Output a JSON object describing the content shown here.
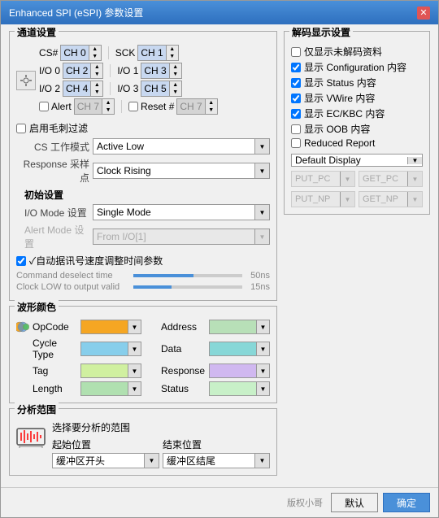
{
  "title": "Enhanced SPI (eSPI) 参数设置",
  "close_btn": "✕",
  "sections": {
    "channel": "通道设置",
    "decode": "解码显示设置",
    "wave": "波形颜色",
    "analysis": "分析范围"
  },
  "channels": {
    "cs_label": "CS#",
    "cs_val": "CH 0",
    "sck_label": "SCK",
    "sck_val": "CH 1",
    "io0_label": "I/O 0",
    "io0_val": "CH 2",
    "io1_label": "I/O 1",
    "io1_val": "CH 3",
    "io2_label": "I/O 2",
    "io2_val": "CH 4",
    "io3_label": "I/O 3",
    "io3_val": "CH 5",
    "alert_label": "Alert",
    "alert_val": "CH 7",
    "reset_label": "Reset #",
    "reset_val": "CH 7"
  },
  "filter": {
    "enable_label": "启用毛刺过滤",
    "cs_mode_label": "CS 工作模式",
    "cs_mode_val": "Active Low",
    "response_label": "Response 采样点",
    "response_val": "Clock Rising"
  },
  "init": {
    "label": "初始设置",
    "io_mode_label": "I/O Mode 设置",
    "io_mode_val": "Single Mode",
    "alert_mode_label": "Alert Mode 设置",
    "alert_mode_val": "From I/O[1]",
    "alert_mode_disabled": true
  },
  "auto": {
    "label": "✓自动据讯号速度调整时间参数",
    "cmd_label": "Command deselect time",
    "cmd_val": "50ns",
    "clk_label": "Clock LOW to output valid",
    "clk_val": "15ns"
  },
  "decode_settings": {
    "items": [
      {
        "label": "仅显示未解码资料",
        "checked": false
      },
      {
        "label": "显示 Configuration 内容",
        "checked": true
      },
      {
        "label": "显示 Status 内容",
        "checked": true
      },
      {
        "label": "显示 VWire 内容",
        "checked": true
      },
      {
        "label": "显示 EC/KBC 内容",
        "checked": true
      },
      {
        "label": "显示 OOB 内容",
        "checked": false
      },
      {
        "label": "Reduced Report",
        "checked": false
      }
    ],
    "display_dropdown": "Default Display",
    "sub_dropdowns": [
      "PUT_PC",
      "GET_PC",
      "PUT_NP",
      "GET_NP"
    ]
  },
  "wave_colors": {
    "items": [
      {
        "label": "OpCode",
        "color": "#f5a623",
        "has_icon": true
      },
      {
        "label": "Address",
        "color": "#b8e0b8"
      },
      {
        "label": "Cycle Type",
        "color": "#87ceeb",
        "has_icon": false
      },
      {
        "label": "Data",
        "color": "#87d7d7"
      },
      {
        "label": "Tag",
        "color": "#d0f0a0"
      },
      {
        "label": "Response",
        "color": "#d0b8f0"
      },
      {
        "label": "Length",
        "color": "#b0e0b0"
      },
      {
        "label": "Status",
        "color": "#c8f0c8"
      }
    ]
  },
  "analysis": {
    "desc": "选择要分析的范围",
    "start_label": "起始位置",
    "start_val": "缓冲区开头",
    "end_label": "结束位置",
    "end_val": "缓冲区结尾"
  },
  "buttons": {
    "default": "默认",
    "ok": "确定",
    "watermark": "版权小哥"
  }
}
